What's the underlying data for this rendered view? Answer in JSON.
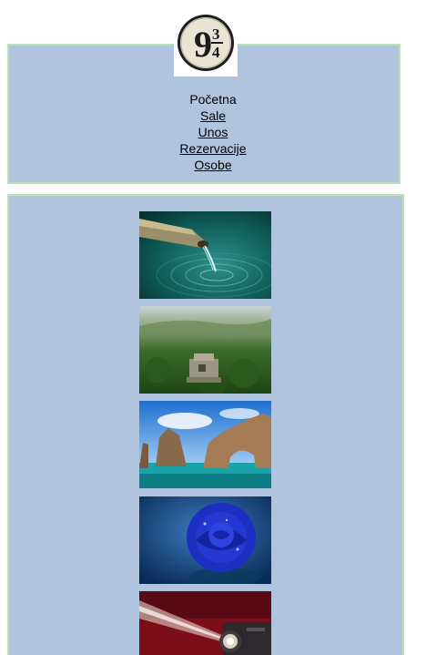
{
  "logo": {
    "big_digit": "9",
    "fraction_top": "3",
    "fraction_bottom": "4"
  },
  "nav": {
    "items": [
      {
        "label": "Početna",
        "link": false
      },
      {
        "label": "Sale",
        "link": true
      },
      {
        "label": "Unos",
        "link": true
      },
      {
        "label": "Rezervacije",
        "link": true
      },
      {
        "label": "Osobe",
        "link": true
      }
    ]
  },
  "gallery": {
    "images": [
      {
        "subject": "bamboo spout pouring water into green pond"
      },
      {
        "subject": "ancient stone ruin in tropical jungle"
      },
      {
        "subject": "rock arch over turquoise sea"
      },
      {
        "subject": "blue rose with water droplets"
      },
      {
        "subject": "projector lens with light beam"
      }
    ]
  },
  "colors": {
    "panel_bg": "#b0c4de",
    "panel_border": "#b6e3b6"
  }
}
